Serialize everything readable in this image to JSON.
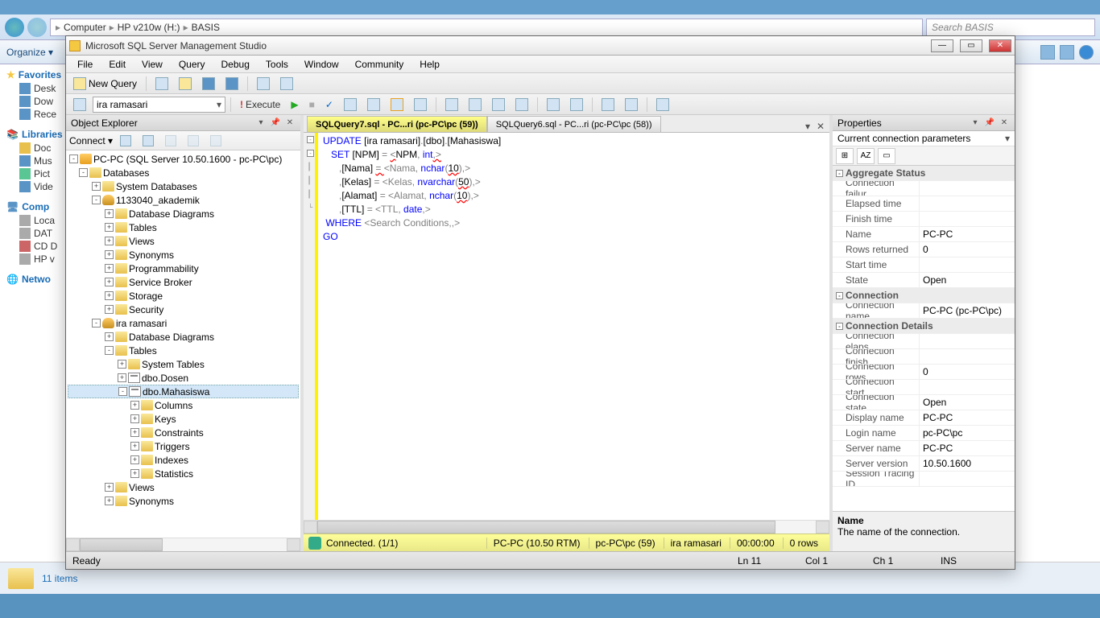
{
  "explorer": {
    "crumbs": [
      "Computer",
      "HP v210w (H:)",
      "BASIS"
    ],
    "search_placeholder": "Search BASIS",
    "organize": "Organize ▾",
    "favorites": {
      "hdr": "Favorites",
      "items": [
        "Desk",
        "Dow",
        "Rece"
      ]
    },
    "libraries": {
      "hdr": "Libraries",
      "items": [
        "Doc",
        "Mus",
        "Pict",
        "Vide"
      ]
    },
    "computer": {
      "hdr": "Comp",
      "items": [
        "Loca",
        "DAT",
        "CD D",
        "HP v"
      ]
    },
    "network": {
      "hdr": "Netwo"
    },
    "status": "11 items"
  },
  "ssms": {
    "title": "Microsoft SQL Server Management Studio",
    "menu": [
      "File",
      "Edit",
      "View",
      "Query",
      "Debug",
      "Tools",
      "Window",
      "Community",
      "Help"
    ],
    "newquery": "New Query",
    "dbsel": "ira ramasari",
    "execute": "Execute",
    "oe": {
      "title": "Object Explorer",
      "connect": "Connect ▾",
      "root": "PC-PC (SQL Server 10.50.1600 - pc-PC\\pc)",
      "tree": [
        {
          "lvl": 1,
          "exp": "-",
          "icn": "fold",
          "txt": "Databases"
        },
        {
          "lvl": 2,
          "exp": "+",
          "icn": "fold",
          "txt": "System Databases"
        },
        {
          "lvl": 2,
          "exp": "-",
          "icn": "db",
          "txt": "1133040_akademik"
        },
        {
          "lvl": 3,
          "exp": "+",
          "icn": "fold",
          "txt": "Database Diagrams"
        },
        {
          "lvl": 3,
          "exp": "+",
          "icn": "fold",
          "txt": "Tables"
        },
        {
          "lvl": 3,
          "exp": "+",
          "icn": "fold",
          "txt": "Views"
        },
        {
          "lvl": 3,
          "exp": "+",
          "icn": "fold",
          "txt": "Synonyms"
        },
        {
          "lvl": 3,
          "exp": "+",
          "icn": "fold",
          "txt": "Programmability"
        },
        {
          "lvl": 3,
          "exp": "+",
          "icn": "fold",
          "txt": "Service Broker"
        },
        {
          "lvl": 3,
          "exp": "+",
          "icn": "fold",
          "txt": "Storage"
        },
        {
          "lvl": 3,
          "exp": "+",
          "icn": "fold",
          "txt": "Security"
        },
        {
          "lvl": 2,
          "exp": "-",
          "icn": "db",
          "txt": "ira ramasari"
        },
        {
          "lvl": 3,
          "exp": "+",
          "icn": "fold",
          "txt": "Database Diagrams"
        },
        {
          "lvl": 3,
          "exp": "-",
          "icn": "fold",
          "txt": "Tables"
        },
        {
          "lvl": 4,
          "exp": "+",
          "icn": "fold",
          "txt": "System Tables"
        },
        {
          "lvl": 4,
          "exp": "+",
          "icn": "tbl",
          "txt": "dbo.Dosen"
        },
        {
          "lvl": 4,
          "exp": "-",
          "icn": "tbl",
          "txt": "dbo.Mahasiswa",
          "sel": true
        },
        {
          "lvl": 5,
          "exp": "+",
          "icn": "fold",
          "txt": "Columns"
        },
        {
          "lvl": 5,
          "exp": "+",
          "icn": "fold",
          "txt": "Keys"
        },
        {
          "lvl": 5,
          "exp": "+",
          "icn": "fold",
          "txt": "Constraints"
        },
        {
          "lvl": 5,
          "exp": "+",
          "icn": "fold",
          "txt": "Triggers"
        },
        {
          "lvl": 5,
          "exp": "+",
          "icn": "fold",
          "txt": "Indexes"
        },
        {
          "lvl": 5,
          "exp": "+",
          "icn": "fold",
          "txt": "Statistics"
        },
        {
          "lvl": 3,
          "exp": "+",
          "icn": "fold",
          "txt": "Views"
        },
        {
          "lvl": 3,
          "exp": "+",
          "icn": "fold",
          "txt": "Synonyms"
        }
      ]
    },
    "tabs": {
      "active": "SQLQuery7.sql - PC...ri (pc-PC\\pc (59))",
      "inactive": "SQLQuery6.sql - PC...ri (pc-PC\\pc (58))"
    },
    "sql": {
      "l1a": "UPDATE ",
      "l1b": "[ira ramasari]",
      "l1c": ".",
      "l1d": "[dbo]",
      "l1e": ".",
      "l1f": "[Mahasiswa]",
      "l2a": "   SET ",
      "l2b": "[NPM] ",
      "l2c": "= ",
      "l2d": "<",
      "l2e": "NPM",
      "l2f": ", ",
      "l2g": "int",
      "l2h": ",>",
      "l3a": "      ,",
      "l3b": "[Nama] ",
      "l3c": "= ",
      "l3d": "<Nama",
      "l3e": ", ",
      "l3f": "nchar",
      "l3g": "(",
      "l3h": "10",
      "l3i": "),>",
      "l4a": "      ,",
      "l4b": "[Kelas] ",
      "l4c": "= ",
      "l4d": "<Kelas",
      "l4e": ", ",
      "l4f": "nvarchar",
      "l4g": "(",
      "l4h": "50",
      "l4i": "),>",
      "l5a": "      ,",
      "l5b": "[Alamat] ",
      "l5c": "= ",
      "l5d": "<Alamat",
      "l5e": ", ",
      "l5f": "nchar",
      "l5g": "(",
      "l5h": "10",
      "l5i": "),>",
      "l6a": "      ,",
      "l6b": "[TTL] ",
      "l6c": "= ",
      "l6d": "<TTL",
      "l6e": ", ",
      "l6f": "date",
      "l6g": ",>",
      "l7a": " WHERE ",
      "l7b": "<Search Conditions,,>",
      "l8": "GO"
    },
    "qstatus": {
      "conn": "Connected. (1/1)",
      "server": "PC-PC (10.50 RTM)",
      "user": "pc-PC\\pc (59)",
      "db": "ira ramasari",
      "time": "00:00:00",
      "rows": "0 rows"
    },
    "props": {
      "title": "Properties",
      "subtitle": "Current connection parameters",
      "cats": [
        {
          "cat": "Aggregate Status",
          "rows": [
            {
              "k": "Connection failur",
              "v": ""
            },
            {
              "k": "Elapsed time",
              "v": ""
            },
            {
              "k": "Finish time",
              "v": ""
            },
            {
              "k": "Name",
              "v": "PC-PC"
            },
            {
              "k": "Rows returned",
              "v": "0"
            },
            {
              "k": "Start time",
              "v": ""
            },
            {
              "k": "State",
              "v": "Open"
            }
          ]
        },
        {
          "cat": "Connection",
          "rows": [
            {
              "k": "Connection name",
              "v": "PC-PC (pc-PC\\pc)"
            }
          ]
        },
        {
          "cat": "Connection Details",
          "rows": [
            {
              "k": "Connection elaps",
              "v": ""
            },
            {
              "k": "Connection finish",
              "v": ""
            },
            {
              "k": "Connection rows",
              "v": "0"
            },
            {
              "k": "Connection start",
              "v": ""
            },
            {
              "k": "Connection state",
              "v": "Open"
            },
            {
              "k": "Display name",
              "v": "PC-PC"
            },
            {
              "k": "Login name",
              "v": "pc-PC\\pc"
            },
            {
              "k": "Server name",
              "v": "PC-PC"
            },
            {
              "k": "Server version",
              "v": "10.50.1600"
            },
            {
              "k": "Session Tracing ID",
              "v": ""
            }
          ]
        }
      ],
      "desc_name": "Name",
      "desc_text": "The name of the connection."
    },
    "status": {
      "ready": "Ready",
      "ln": "Ln 11",
      "col": "Col 1",
      "ch": "Ch 1",
      "ins": "INS"
    }
  }
}
